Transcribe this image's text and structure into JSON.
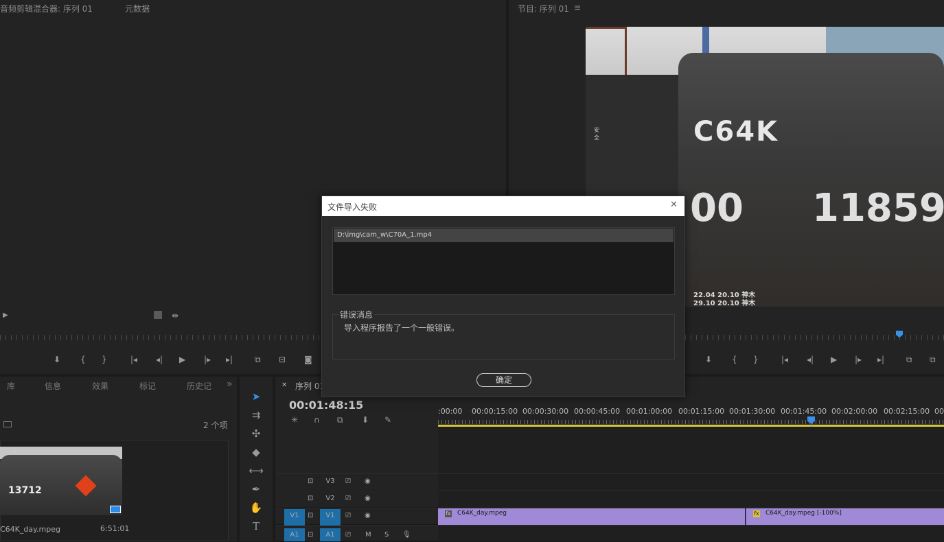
{
  "left_panel": {
    "title": "音频剪辑混合器: 序列 01",
    "tab2": "元数据"
  },
  "program_panel": {
    "title": "节目: 序列 01",
    "menu_icon": "≡"
  },
  "video_frame_text": {
    "code": "C64K",
    "number_left": "00",
    "number_right": "11859",
    "small1": "22.04 20.10 神木",
    "small2": "29.10 20.10 神木",
    "label": "安全"
  },
  "project_panel": {
    "tabs": [
      "库",
      "信息",
      "效果",
      "标记",
      "历史记"
    ],
    "more": "»",
    "item_count": "2 个项",
    "item": {
      "name": "C64K_day.mpeg",
      "duration": "6:51:01",
      "thumb_number": "13712"
    }
  },
  "timeline": {
    "tab_label": "序列 01",
    "timecode": "00:01:48:15",
    "ruler_labels": [
      ":00:00",
      "00:00:15:00",
      "00:00:30:00",
      "00:00:45:00",
      "00:01:00:00",
      "00:01:15:00",
      "00:01:30:00",
      "00:01:45:00",
      "00:02:00:00",
      "00:02:15:00",
      "00:0"
    ],
    "tracks": [
      {
        "name": "V3",
        "src": ""
      },
      {
        "name": "V2",
        "src": ""
      },
      {
        "name": "V1",
        "src": "V1"
      },
      {
        "name": "A1",
        "src": "A1",
        "m": "M",
        "s": "S"
      }
    ],
    "clips": [
      {
        "label": "C64K_day.mpeg"
      },
      {
        "label": "C64K_day.mpeg [-100%]"
      }
    ]
  },
  "dialog": {
    "title": "文件导入失败",
    "close": "✕",
    "file_path": "D:\\img\\cam_w\\C70A_1.mp4",
    "group_label": "错误消息",
    "message": "导入程序报告了一个一般错误。",
    "ok_button": "确定"
  },
  "colors": {
    "accent": "#2d8ceb",
    "clip": "#a089d6",
    "track_blue": "#1e6fa8",
    "playhead": "#3b8fe8"
  }
}
